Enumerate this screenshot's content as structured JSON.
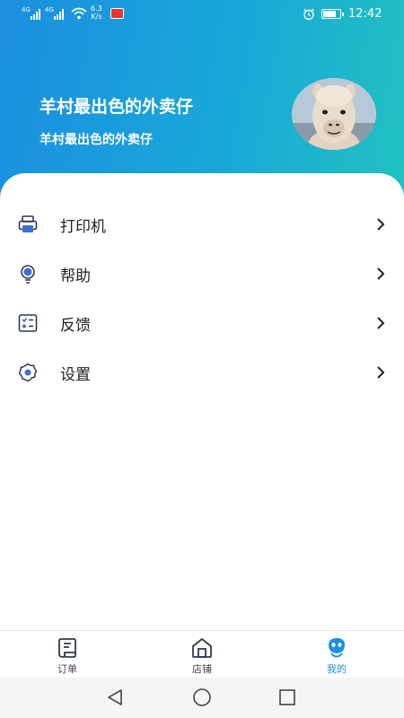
{
  "status_bar": {
    "network_1": "4G",
    "network_2": "4G",
    "speed_value": "6.3",
    "speed_unit": "K/s",
    "time": "12:42",
    "icons": [
      "signal-icon",
      "wifi-icon",
      "app-notification-icon",
      "alarm-icon",
      "battery-icon"
    ]
  },
  "profile": {
    "name": "羊村最出色的外卖仔",
    "subtitle": "羊村最出色的外卖仔",
    "avatar": "alpaca-avatar"
  },
  "menu": {
    "items": [
      {
        "label": "打印机",
        "icon": "printer-icon"
      },
      {
        "label": "帮助",
        "icon": "lightbulb-icon"
      },
      {
        "label": "反馈",
        "icon": "feedback-checklist-icon"
      },
      {
        "label": "设置",
        "icon": "settings-gear-icon"
      }
    ]
  },
  "tabbar": {
    "tabs": [
      {
        "label": "订单",
        "icon": "order-receipt-icon",
        "active": false
      },
      {
        "label": "店铺",
        "icon": "store-home-icon",
        "active": false
      },
      {
        "label": "我的",
        "icon": "profile-face-icon",
        "active": true
      }
    ],
    "active_color": "#1a8fe8"
  },
  "colors": {
    "header_gradient_start": "#1b8fe0",
    "header_gradient_end": "#21c2c0",
    "icon_blue": "#3d6fd6",
    "icon_dark": "#2e3a4f"
  }
}
